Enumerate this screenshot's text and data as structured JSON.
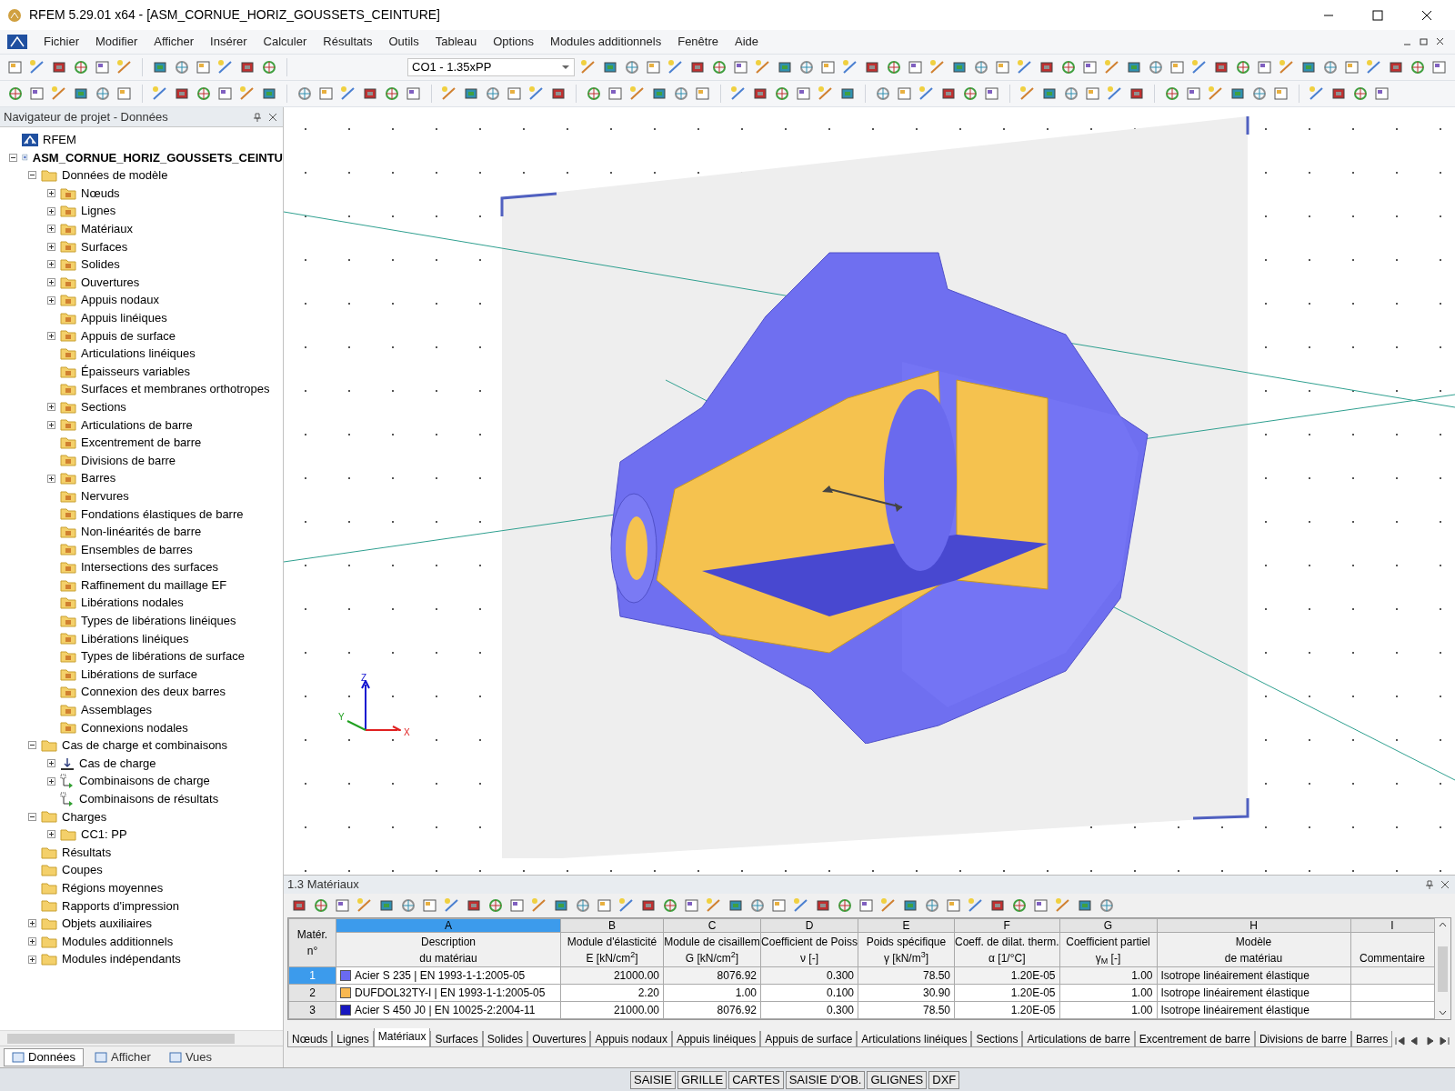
{
  "window": {
    "title": "RFEM 5.29.01 x64 - [ASM_CORNUE_HORIZ_GOUSSETS_CEINTURE]"
  },
  "menu": [
    {
      "label": "Fichier"
    },
    {
      "label": "Modifier"
    },
    {
      "label": "Afficher"
    },
    {
      "label": "Insérer"
    },
    {
      "label": "Calculer"
    },
    {
      "label": "Résultats"
    },
    {
      "label": "Outils"
    },
    {
      "label": "Tableau"
    },
    {
      "label": "Options"
    },
    {
      "label": "Modules additionnels"
    },
    {
      "label": "Fenêtre"
    },
    {
      "label": "Aide"
    }
  ],
  "combo": {
    "value": "CO1 - 1.35xPP"
  },
  "navigator": {
    "title": "Navigateur de projet - Données",
    "tree": [
      {
        "label": "RFEM",
        "kind": "app"
      },
      {
        "label": "ASM_CORNUE_HORIZ_GOUSSETS_CEINTU",
        "kind": "model",
        "expanded": true,
        "children": [
          {
            "label": "Données de modèle",
            "kind": "folder",
            "expanded": true,
            "children": [
              {
                "label": "Nœuds",
                "kind": "item",
                "expanded": false
              },
              {
                "label": "Lignes",
                "kind": "item",
                "expanded": false
              },
              {
                "label": "Matériaux",
                "kind": "item",
                "expanded": false
              },
              {
                "label": "Surfaces",
                "kind": "item",
                "expanded": false
              },
              {
                "label": "Solides",
                "kind": "item",
                "expanded": false
              },
              {
                "label": "Ouvertures",
                "kind": "item",
                "expanded": false
              },
              {
                "label": "Appuis nodaux",
                "kind": "item",
                "expanded": false
              },
              {
                "label": "Appuis linéiques",
                "kind": "item"
              },
              {
                "label": "Appuis de surface",
                "kind": "item",
                "expanded": false
              },
              {
                "label": "Articulations linéiques",
                "kind": "item"
              },
              {
                "label": "Épaisseurs variables",
                "kind": "item"
              },
              {
                "label": "Surfaces et membranes orthotropes",
                "kind": "item"
              },
              {
                "label": "Sections",
                "kind": "item",
                "expanded": false
              },
              {
                "label": "Articulations de barre",
                "kind": "item",
                "expanded": false
              },
              {
                "label": "Excentrement de barre",
                "kind": "item"
              },
              {
                "label": "Divisions de barre",
                "kind": "item"
              },
              {
                "label": "Barres",
                "kind": "item",
                "expanded": false
              },
              {
                "label": "Nervures",
                "kind": "item"
              },
              {
                "label": "Fondations élastiques de barre",
                "kind": "item"
              },
              {
                "label": "Non-linéarités de barre",
                "kind": "item"
              },
              {
                "label": "Ensembles de barres",
                "kind": "item"
              },
              {
                "label": "Intersections des surfaces",
                "kind": "item"
              },
              {
                "label": "Raffinement du maillage EF",
                "kind": "item"
              },
              {
                "label": "Libérations nodales",
                "kind": "item"
              },
              {
                "label": "Types de libérations linéiques",
                "kind": "item"
              },
              {
                "label": "Libérations linéiques",
                "kind": "item"
              },
              {
                "label": "Types de libérations de surface",
                "kind": "item"
              },
              {
                "label": "Libérations de surface",
                "kind": "item"
              },
              {
                "label": "Connexion des deux barres",
                "kind": "item"
              },
              {
                "label": "Assemblages",
                "kind": "item"
              },
              {
                "label": "Connexions nodales",
                "kind": "item"
              }
            ]
          },
          {
            "label": "Cas de charge et combinaisons",
            "kind": "folder",
            "expanded": true,
            "children": [
              {
                "label": "Cas de charge",
                "kind": "load",
                "expanded": false
              },
              {
                "label": "Combinaisons de charge",
                "kind": "combo",
                "expanded": false
              },
              {
                "label": "Combinaisons de résultats",
                "kind": "combo"
              }
            ]
          },
          {
            "label": "Charges",
            "kind": "folder",
            "expanded": true,
            "children": [
              {
                "label": "CC1: PP",
                "kind": "folder",
                "expanded": false
              }
            ]
          },
          {
            "label": "Résultats",
            "kind": "folder"
          },
          {
            "label": "Coupes",
            "kind": "folder"
          },
          {
            "label": "Régions moyennes",
            "kind": "folder"
          },
          {
            "label": "Rapports d'impression",
            "kind": "folder"
          },
          {
            "label": "Objets auxiliaires",
            "kind": "folder",
            "expanded": false
          },
          {
            "label": "Modules additionnels",
            "kind": "folder",
            "expanded": false
          },
          {
            "label": "Modules indépendants",
            "kind": "folder",
            "expanded": false
          }
        ]
      }
    ],
    "tabs": [
      {
        "label": "Données",
        "selected": true
      },
      {
        "label": "Afficher",
        "selected": false
      },
      {
        "label": "Vues",
        "selected": false
      }
    ]
  },
  "viewport": {
    "axes": {
      "z": "Z",
      "y": "Y",
      "x": "X"
    }
  },
  "table": {
    "title": "1.3 Matériaux",
    "row_header": [
      "Matér.",
      "n°"
    ],
    "columns": [
      {
        "letter": "A",
        "label": [
          "Description",
          "du matériau"
        ]
      },
      {
        "letter": "B",
        "label": [
          "Module d'élasticité",
          "E [kN/cm$^{2}$]"
        ]
      },
      {
        "letter": "C",
        "label": [
          "Module de cisaillem",
          "G [kN/cm$^{2}$]"
        ]
      },
      {
        "letter": "D",
        "label": [
          "Coefficient de Poiss",
          "ν [-]"
        ]
      },
      {
        "letter": "E",
        "label": [
          "Poids spécifique",
          "γ [kN/m$^{3}$]"
        ]
      },
      {
        "letter": "F",
        "label": [
          "Coeff. de dilat. therm.",
          "α [1/°C]"
        ]
      },
      {
        "letter": "G",
        "label": [
          "Coefficient partiel",
          "γ$_{M}$ [-]"
        ]
      },
      {
        "letter": "H",
        "label": [
          "Modèle",
          "de matériau"
        ]
      },
      {
        "letter": "I",
        "label": [
          "Commentaire"
        ]
      }
    ],
    "rows": [
      {
        "no": "1",
        "selected": true,
        "color": "#6a6af2",
        "cells": [
          "Acier S 235 | EN 1993-1-1:2005-05",
          "21000.00",
          "8076.92",
          "0.300",
          "78.50",
          "1.20E-05",
          "1.00",
          "Isotrope linéairement élastique",
          ""
        ]
      },
      {
        "no": "2",
        "selected": false,
        "color": "#f8b850",
        "cells": [
          "DUFDOL32TY-I | EN 1993-1-1:2005-05",
          "2.20",
          "1.00",
          "0.100",
          "30.90",
          "1.20E-05",
          "1.00",
          "Isotrope linéairement élastique",
          ""
        ]
      },
      {
        "no": "3",
        "selected": false,
        "color": "#1818c0",
        "cells": [
          "Acier S 450 J0 | EN 10025-2:2004-11",
          "21000.00",
          "8076.92",
          "0.300",
          "78.50",
          "1.20E-05",
          "1.00",
          "Isotrope linéairement élastique",
          ""
        ]
      }
    ],
    "tabs": [
      {
        "label": "Nœuds",
        "selected": false
      },
      {
        "label": "Lignes",
        "selected": false
      },
      {
        "label": "Matériaux",
        "selected": true
      },
      {
        "label": "Surfaces",
        "selected": false
      },
      {
        "label": "Solides",
        "selected": false
      },
      {
        "label": "Ouvertures",
        "selected": false
      },
      {
        "label": "Appuis nodaux",
        "selected": false
      },
      {
        "label": "Appuis linéiques",
        "selected": false
      },
      {
        "label": "Appuis de surface",
        "selected": false
      },
      {
        "label": "Articulations linéiques",
        "selected": false
      },
      {
        "label": "Sections",
        "selected": false
      },
      {
        "label": "Articulations de barre",
        "selected": false
      },
      {
        "label": "Excentrement de barre",
        "selected": false
      },
      {
        "label": "Divisions de barre",
        "selected": false
      },
      {
        "label": "Barres",
        "selected": false
      }
    ]
  },
  "status_bar": [
    {
      "label": "SAISIE"
    },
    {
      "label": "GRILLE"
    },
    {
      "label": "CARTES"
    },
    {
      "label": "SAISIE D'OB."
    },
    {
      "label": "GLIGNES"
    },
    {
      "label": "DXF"
    }
  ]
}
